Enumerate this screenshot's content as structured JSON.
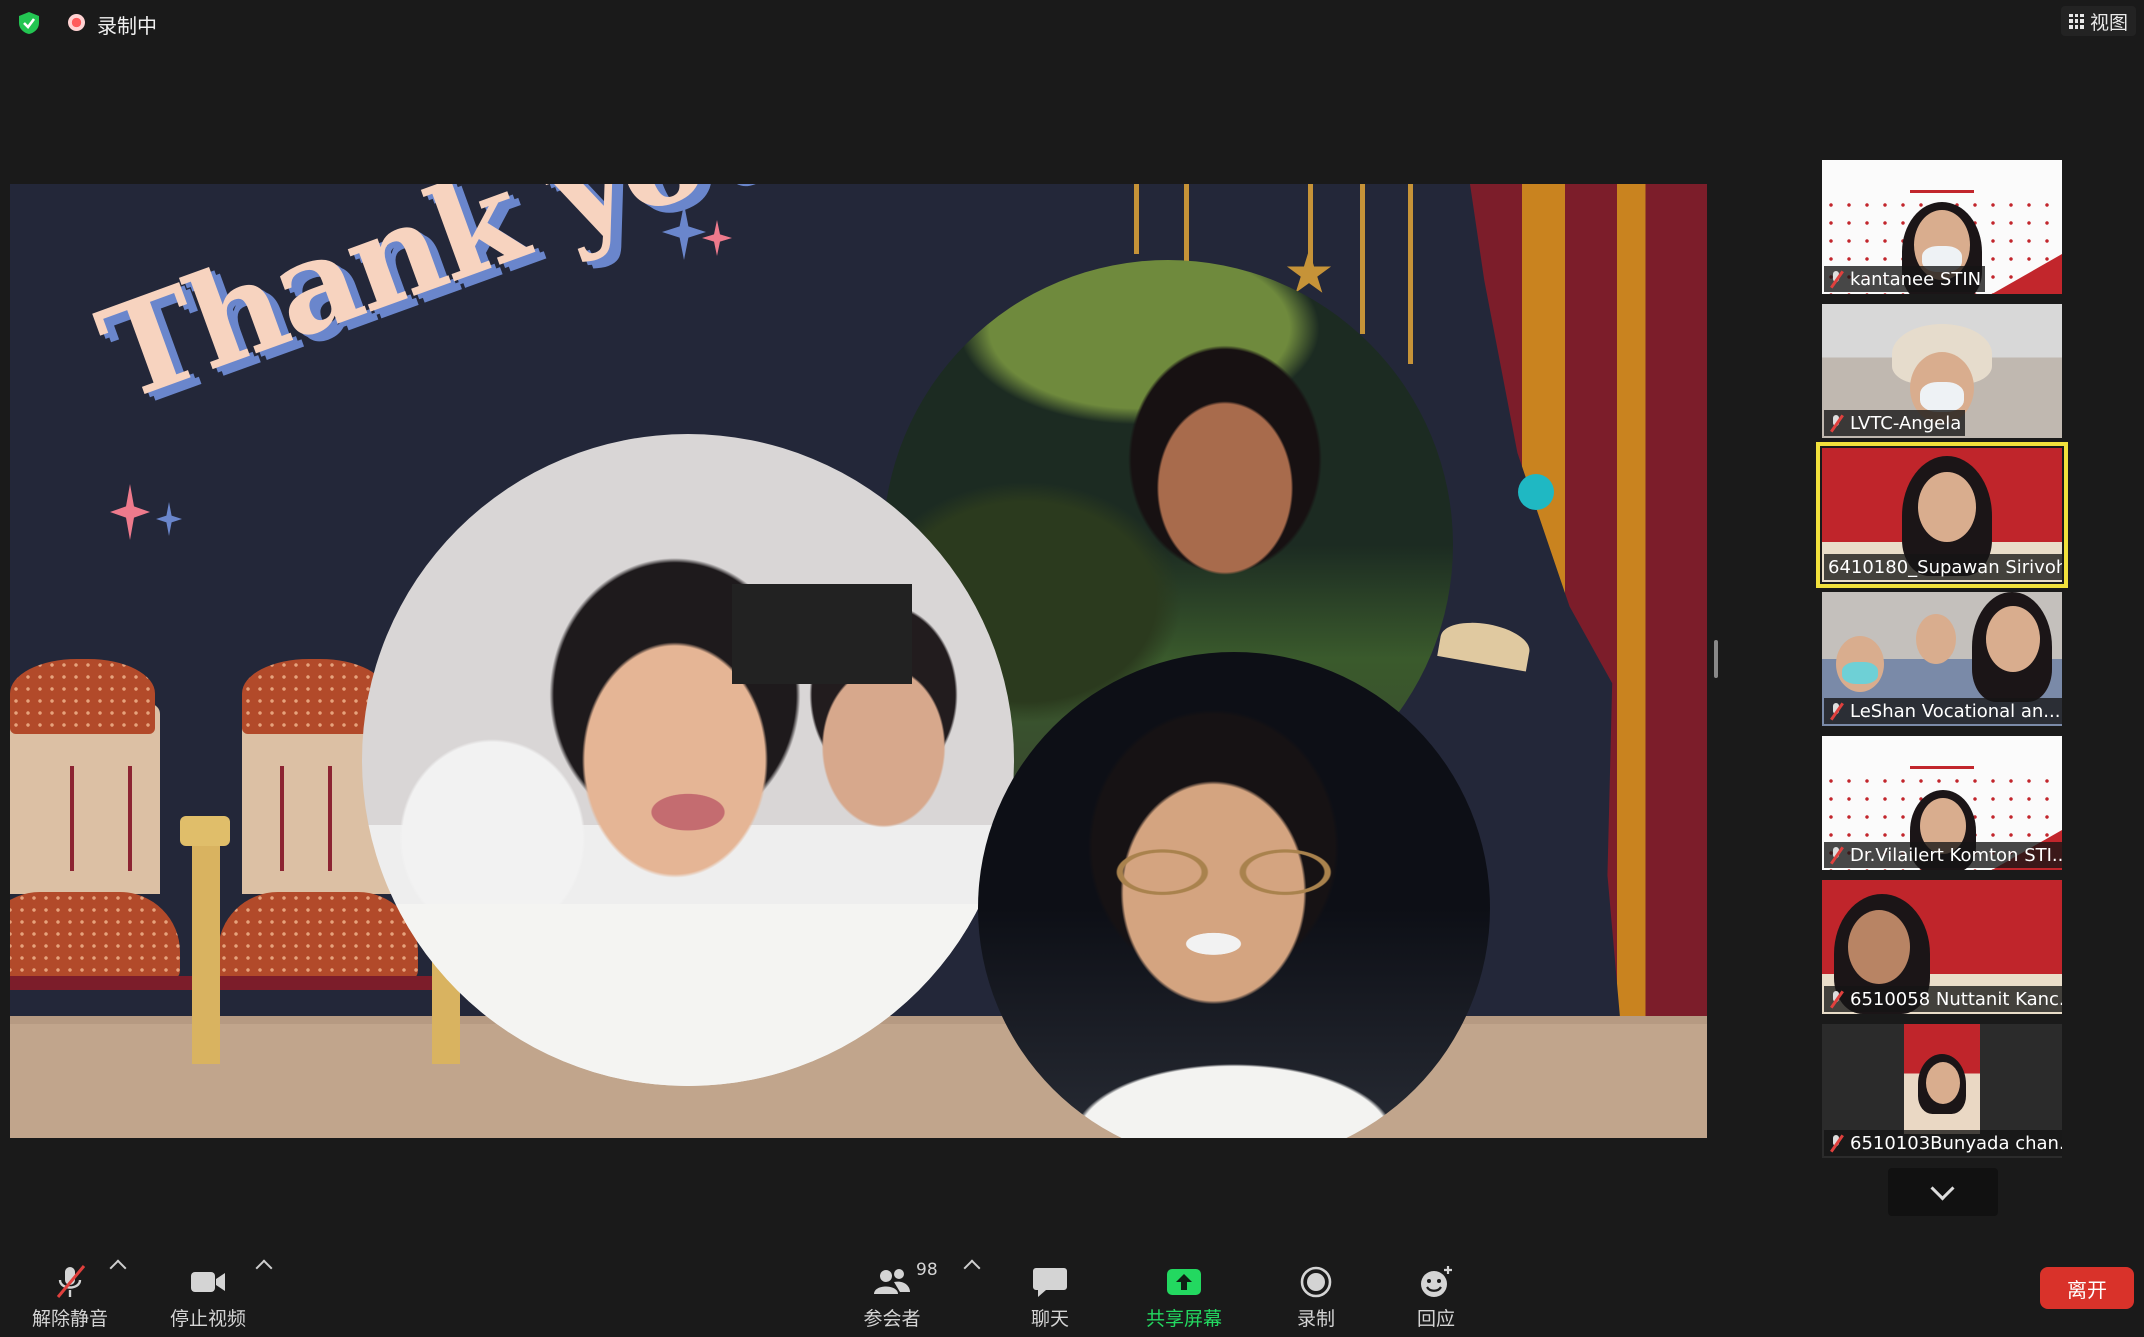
{
  "top_bar": {
    "recording_label": "录制中",
    "view_label": "视图"
  },
  "shared_screen": {
    "slide_title": "Thank you"
  },
  "participants": [
    {
      "name": "kantanee STIN",
      "muted": true
    },
    {
      "name": "LVTC-Angela",
      "muted": true
    },
    {
      "name": "6410180_Supawan Sirivoh...",
      "muted": false,
      "active_speaker": true
    },
    {
      "name": "LeShan Vocational an...",
      "muted": true
    },
    {
      "name": "Dr.Vilailert Komton STI...",
      "muted": true
    },
    {
      "name": "6510058 Nuttanit Kanc...",
      "muted": true
    },
    {
      "name": "6510103Bunyada chan...",
      "muted": true
    }
  ],
  "toolbar": {
    "unmute_label": "解除静音",
    "stop_video_label": "停止视频",
    "participants_label": "参会者",
    "participants_count": "98",
    "chat_label": "聊天",
    "share_screen_label": "共享屏幕",
    "record_label": "录制",
    "reactions_label": "回应",
    "leave_label": "离开"
  },
  "colors": {
    "active_speaker_border": "#f2e13c",
    "share_green": "#23d860",
    "leave_red": "#d9322a",
    "recording_red": "#ff5b5b"
  }
}
